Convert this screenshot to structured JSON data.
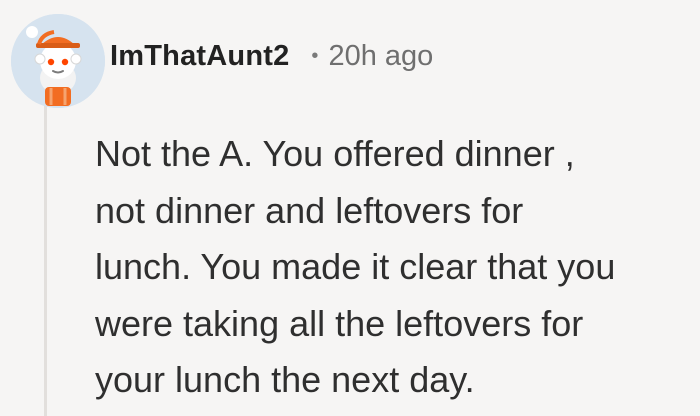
{
  "comment": {
    "author": "ImThatAunt2",
    "separator": "•",
    "timestamp": "20h ago",
    "body_lines": [
      "Not the A. You offered dinner ,",
      "not dinner and leftovers for",
      "lunch. You made it clear that you",
      "were taking all the leftovers for",
      "your lunch the next day."
    ]
  },
  "avatar_icon": "snoo-avatar-icon",
  "colors": {
    "background": "#f6f5f4",
    "thread_line": "#e2dfdc",
    "avatar_background": "#d6e3ef",
    "hat_orange": "#f26d22",
    "eye_red": "#ff4500"
  }
}
